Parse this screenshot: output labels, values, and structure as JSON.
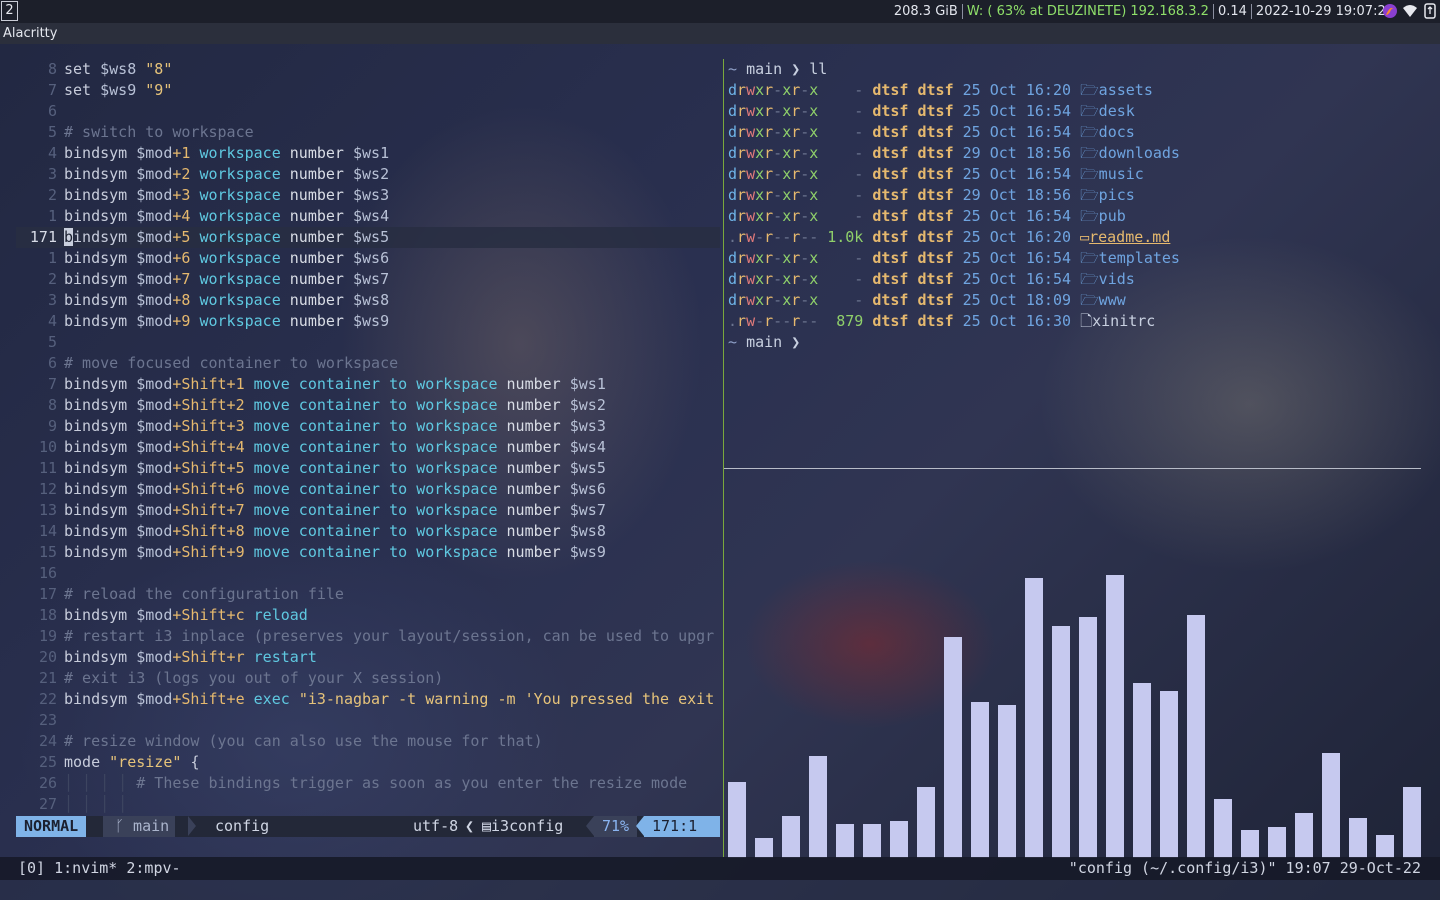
{
  "topbar": {
    "workspace": "2",
    "disk": "208.3 GiB",
    "wifi": "W: ( 63% at DEUZINETE) 192.168.3.2",
    "load": "0.14",
    "datetime": "2022-10-29 19:07:25"
  },
  "window": {
    "title": "Alacritty"
  },
  "nvim": {
    "lines": [
      {
        "num": "8",
        "parts": [
          [
            "kw",
            "set "
          ],
          [
            "var",
            "$ws8 "
          ],
          [
            "str",
            "\"8\""
          ]
        ]
      },
      {
        "num": "7",
        "parts": [
          [
            "kw",
            "set "
          ],
          [
            "var",
            "$ws9 "
          ],
          [
            "str",
            "\"9\""
          ]
        ]
      },
      {
        "num": "6",
        "parts": []
      },
      {
        "num": "5",
        "parts": [
          [
            "cm",
            "# switch to workspace"
          ]
        ]
      },
      {
        "num": "4",
        "parts": [
          [
            "kw",
            "bindsym "
          ],
          [
            "var",
            "$mod"
          ],
          [
            "mod",
            "+1 "
          ],
          [
            "fn",
            "workspace "
          ],
          [
            "wh",
            "number "
          ],
          [
            "var",
            "$ws1"
          ]
        ]
      },
      {
        "num": "3",
        "parts": [
          [
            "kw",
            "bindsym "
          ],
          [
            "var",
            "$mod"
          ],
          [
            "mod",
            "+2 "
          ],
          [
            "fn",
            "workspace "
          ],
          [
            "wh",
            "number "
          ],
          [
            "var",
            "$ws2"
          ]
        ]
      },
      {
        "num": "2",
        "parts": [
          [
            "kw",
            "bindsym "
          ],
          [
            "var",
            "$mod"
          ],
          [
            "mod",
            "+3 "
          ],
          [
            "fn",
            "workspace "
          ],
          [
            "wh",
            "number "
          ],
          [
            "var",
            "$ws3"
          ]
        ]
      },
      {
        "num": "1",
        "parts": [
          [
            "kw",
            "bindsym "
          ],
          [
            "var",
            "$mod"
          ],
          [
            "mod",
            "+4 "
          ],
          [
            "fn",
            "workspace "
          ],
          [
            "wh",
            "number "
          ],
          [
            "var",
            "$ws4"
          ]
        ]
      },
      {
        "num": "171",
        "current": true,
        "parts": [
          [
            "cursor",
            "b"
          ],
          [
            "kw",
            "indsym "
          ],
          [
            "var",
            "$mod"
          ],
          [
            "mod",
            "+5 "
          ],
          [
            "fn",
            "workspace "
          ],
          [
            "wh",
            "number "
          ],
          [
            "var",
            "$ws5"
          ]
        ]
      },
      {
        "num": "1",
        "parts": [
          [
            "kw",
            "bindsym "
          ],
          [
            "var",
            "$mod"
          ],
          [
            "mod",
            "+6 "
          ],
          [
            "fn",
            "workspace "
          ],
          [
            "wh",
            "number "
          ],
          [
            "var",
            "$ws6"
          ]
        ]
      },
      {
        "num": "2",
        "parts": [
          [
            "kw",
            "bindsym "
          ],
          [
            "var",
            "$mod"
          ],
          [
            "mod",
            "+7 "
          ],
          [
            "fn",
            "workspace "
          ],
          [
            "wh",
            "number "
          ],
          [
            "var",
            "$ws7"
          ]
        ]
      },
      {
        "num": "3",
        "parts": [
          [
            "kw",
            "bindsym "
          ],
          [
            "var",
            "$mod"
          ],
          [
            "mod",
            "+8 "
          ],
          [
            "fn",
            "workspace "
          ],
          [
            "wh",
            "number "
          ],
          [
            "var",
            "$ws8"
          ]
        ]
      },
      {
        "num": "4",
        "parts": [
          [
            "kw",
            "bindsym "
          ],
          [
            "var",
            "$mod"
          ],
          [
            "mod",
            "+9 "
          ],
          [
            "fn",
            "workspace "
          ],
          [
            "wh",
            "number "
          ],
          [
            "var",
            "$ws9"
          ]
        ]
      },
      {
        "num": "5",
        "parts": []
      },
      {
        "num": "6",
        "parts": [
          [
            "cm",
            "# move focused container to workspace"
          ]
        ]
      },
      {
        "num": "7",
        "parts": [
          [
            "kw",
            "bindsym "
          ],
          [
            "var",
            "$mod"
          ],
          [
            "mod",
            "+Shift+1 "
          ],
          [
            "fn",
            "move container to workspace "
          ],
          [
            "wh",
            "number "
          ],
          [
            "var",
            "$ws1"
          ]
        ]
      },
      {
        "num": "8",
        "parts": [
          [
            "kw",
            "bindsym "
          ],
          [
            "var",
            "$mod"
          ],
          [
            "mod",
            "+Shift+2 "
          ],
          [
            "fn",
            "move container to workspace "
          ],
          [
            "wh",
            "number "
          ],
          [
            "var",
            "$ws2"
          ]
        ]
      },
      {
        "num": "9",
        "parts": [
          [
            "kw",
            "bindsym "
          ],
          [
            "var",
            "$mod"
          ],
          [
            "mod",
            "+Shift+3 "
          ],
          [
            "fn",
            "move container to workspace "
          ],
          [
            "wh",
            "number "
          ],
          [
            "var",
            "$ws3"
          ]
        ]
      },
      {
        "num": "10",
        "parts": [
          [
            "kw",
            "bindsym "
          ],
          [
            "var",
            "$mod"
          ],
          [
            "mod",
            "+Shift+4 "
          ],
          [
            "fn",
            "move container to workspace "
          ],
          [
            "wh",
            "number "
          ],
          [
            "var",
            "$ws4"
          ]
        ]
      },
      {
        "num": "11",
        "parts": [
          [
            "kw",
            "bindsym "
          ],
          [
            "var",
            "$mod"
          ],
          [
            "mod",
            "+Shift+5 "
          ],
          [
            "fn",
            "move container to workspace "
          ],
          [
            "wh",
            "number "
          ],
          [
            "var",
            "$ws5"
          ]
        ]
      },
      {
        "num": "12",
        "parts": [
          [
            "kw",
            "bindsym "
          ],
          [
            "var",
            "$mod"
          ],
          [
            "mod",
            "+Shift+6 "
          ],
          [
            "fn",
            "move container to workspace "
          ],
          [
            "wh",
            "number "
          ],
          [
            "var",
            "$ws6"
          ]
        ]
      },
      {
        "num": "13",
        "parts": [
          [
            "kw",
            "bindsym "
          ],
          [
            "var",
            "$mod"
          ],
          [
            "mod",
            "+Shift+7 "
          ],
          [
            "fn",
            "move container to workspace "
          ],
          [
            "wh",
            "number "
          ],
          [
            "var",
            "$ws7"
          ]
        ]
      },
      {
        "num": "14",
        "parts": [
          [
            "kw",
            "bindsym "
          ],
          [
            "var",
            "$mod"
          ],
          [
            "mod",
            "+Shift+8 "
          ],
          [
            "fn",
            "move container to workspace "
          ],
          [
            "wh",
            "number "
          ],
          [
            "var",
            "$ws8"
          ]
        ]
      },
      {
        "num": "15",
        "parts": [
          [
            "kw",
            "bindsym "
          ],
          [
            "var",
            "$mod"
          ],
          [
            "mod",
            "+Shift+9 "
          ],
          [
            "fn",
            "move container to workspace "
          ],
          [
            "wh",
            "number "
          ],
          [
            "var",
            "$ws9"
          ]
        ]
      },
      {
        "num": "16",
        "parts": []
      },
      {
        "num": "17",
        "parts": [
          [
            "cm",
            "# reload the configuration file"
          ]
        ]
      },
      {
        "num": "18",
        "parts": [
          [
            "kw",
            "bindsym "
          ],
          [
            "var",
            "$mod"
          ],
          [
            "mod",
            "+Shift+c "
          ],
          [
            "fn",
            "reload"
          ]
        ]
      },
      {
        "num": "19",
        "parts": [
          [
            "cm",
            "# restart i3 inplace (preserves your layout/session, can be used to upgr"
          ]
        ]
      },
      {
        "num": "20",
        "parts": [
          [
            "kw",
            "bindsym "
          ],
          [
            "var",
            "$mod"
          ],
          [
            "mod",
            "+Shift+r "
          ],
          [
            "fn",
            "restart"
          ]
        ]
      },
      {
        "num": "21",
        "parts": [
          [
            "cm",
            "# exit i3 (logs you out of your X session)"
          ]
        ]
      },
      {
        "num": "22",
        "parts": [
          [
            "kw",
            "bindsym "
          ],
          [
            "var",
            "$mod"
          ],
          [
            "mod",
            "+Shift+e "
          ],
          [
            "fn",
            "exec "
          ],
          [
            "str",
            "\"i3-nagbar -t warning -m 'You pressed the exit"
          ]
        ]
      },
      {
        "num": "23",
        "parts": []
      },
      {
        "num": "24",
        "parts": [
          [
            "cm",
            "# resize window (you can also use the mouse for that)"
          ]
        ]
      },
      {
        "num": "25",
        "parts": [
          [
            "kw",
            "mode "
          ],
          [
            "str",
            "\"resize\" "
          ],
          [
            "kw",
            "{"
          ]
        ]
      },
      {
        "num": "26",
        "parts": [
          [
            "indent",
            "│ │ │ │ "
          ],
          [
            "cm",
            "# These bindings trigger as soon as you enter the resize mode"
          ]
        ]
      },
      {
        "num": "27",
        "parts": [
          [
            "indent",
            "│ │ │ │"
          ]
        ]
      }
    ],
    "status": {
      "mode": "NORMAL",
      "branch_icon": "ᚴ",
      "branch": "main",
      "file": "config",
      "encoding": "utf-8",
      "filetype_icon": "▤",
      "filetype": "i3config",
      "percent": "71%",
      "position": "171:1"
    }
  },
  "shell": {
    "prompt": {
      "tilde": "~",
      "branch": "main",
      "arrow": "❯"
    },
    "command": "ll",
    "entries": [
      {
        "perm": "drwxr-xr-x",
        "size": "-",
        "user": "dtsf",
        "group": "dtsf",
        "day": "25",
        "mon": "Oct",
        "time": "16:20",
        "icon": "🗁",
        "name": "assets",
        "kind": "dir"
      },
      {
        "perm": "drwxr-xr-x",
        "size": "-",
        "user": "dtsf",
        "group": "dtsf",
        "day": "25",
        "mon": "Oct",
        "time": "16:54",
        "icon": "🗁",
        "name": "desk",
        "kind": "dir"
      },
      {
        "perm": "drwxr-xr-x",
        "size": "-",
        "user": "dtsf",
        "group": "dtsf",
        "day": "25",
        "mon": "Oct",
        "time": "16:54",
        "icon": "🗁",
        "name": "docs",
        "kind": "dir"
      },
      {
        "perm": "drwxr-xr-x",
        "size": "-",
        "user": "dtsf",
        "group": "dtsf",
        "day": "29",
        "mon": "Oct",
        "time": "18:56",
        "icon": "🗁",
        "name": "downloads",
        "kind": "dir"
      },
      {
        "perm": "drwxr-xr-x",
        "size": "-",
        "user": "dtsf",
        "group": "dtsf",
        "day": "25",
        "mon": "Oct",
        "time": "16:54",
        "icon": "🗁",
        "name": "music",
        "kind": "dir"
      },
      {
        "perm": "drwxr-xr-x",
        "size": "-",
        "user": "dtsf",
        "group": "dtsf",
        "day": "29",
        "mon": "Oct",
        "time": "18:56",
        "icon": "🗁",
        "name": "pics",
        "kind": "dir"
      },
      {
        "perm": "drwxr-xr-x",
        "size": "-",
        "user": "dtsf",
        "group": "dtsf",
        "day": "25",
        "mon": "Oct",
        "time": "16:54",
        "icon": "🗁",
        "name": "pub",
        "kind": "dir"
      },
      {
        "perm": ".rw-r--r--",
        "size": "1.0k",
        "user": "dtsf",
        "group": "dtsf",
        "day": "25",
        "mon": "Oct",
        "time": "16:20",
        "icon": "▭",
        "name": "readme.md",
        "kind": "md"
      },
      {
        "perm": "drwxr-xr-x",
        "size": "-",
        "user": "dtsf",
        "group": "dtsf",
        "day": "25",
        "mon": "Oct",
        "time": "16:54",
        "icon": "🗁",
        "name": "templates",
        "kind": "dir"
      },
      {
        "perm": "drwxr-xr-x",
        "size": "-",
        "user": "dtsf",
        "group": "dtsf",
        "day": "25",
        "mon": "Oct",
        "time": "16:54",
        "icon": "🗁",
        "name": "vids",
        "kind": "dir"
      },
      {
        "perm": "drwxr-xr-x",
        "size": "-",
        "user": "dtsf",
        "group": "dtsf",
        "day": "25",
        "mon": "Oct",
        "time": "18:09",
        "icon": "🗁",
        "name": "www",
        "kind": "dir"
      },
      {
        "perm": ".rw-r--r--",
        "size": "879",
        "user": "dtsf",
        "group": "dtsf",
        "day": "25",
        "mon": "Oct",
        "time": "16:30",
        "icon": "🗋",
        "name": "xinitrc",
        "kind": "file"
      }
    ]
  },
  "visualizer": {
    "bar_color": "#c6c9ef",
    "levels": [
      0.27,
      0.07,
      0.15,
      0.36,
      0.12,
      0.12,
      0.13,
      0.25,
      0.78,
      0.55,
      0.54,
      0.99,
      0.82,
      0.85,
      1.0,
      0.62,
      0.59,
      0.86,
      0.21,
      0.1,
      0.11,
      0.16,
      0.37,
      0.14,
      0.08,
      0.25
    ]
  },
  "tmux": {
    "left": "[0] 1:nvim* 2:mpv-",
    "right": "\"config (~/.config/i3)\" 19:07 29-Oct-22"
  }
}
